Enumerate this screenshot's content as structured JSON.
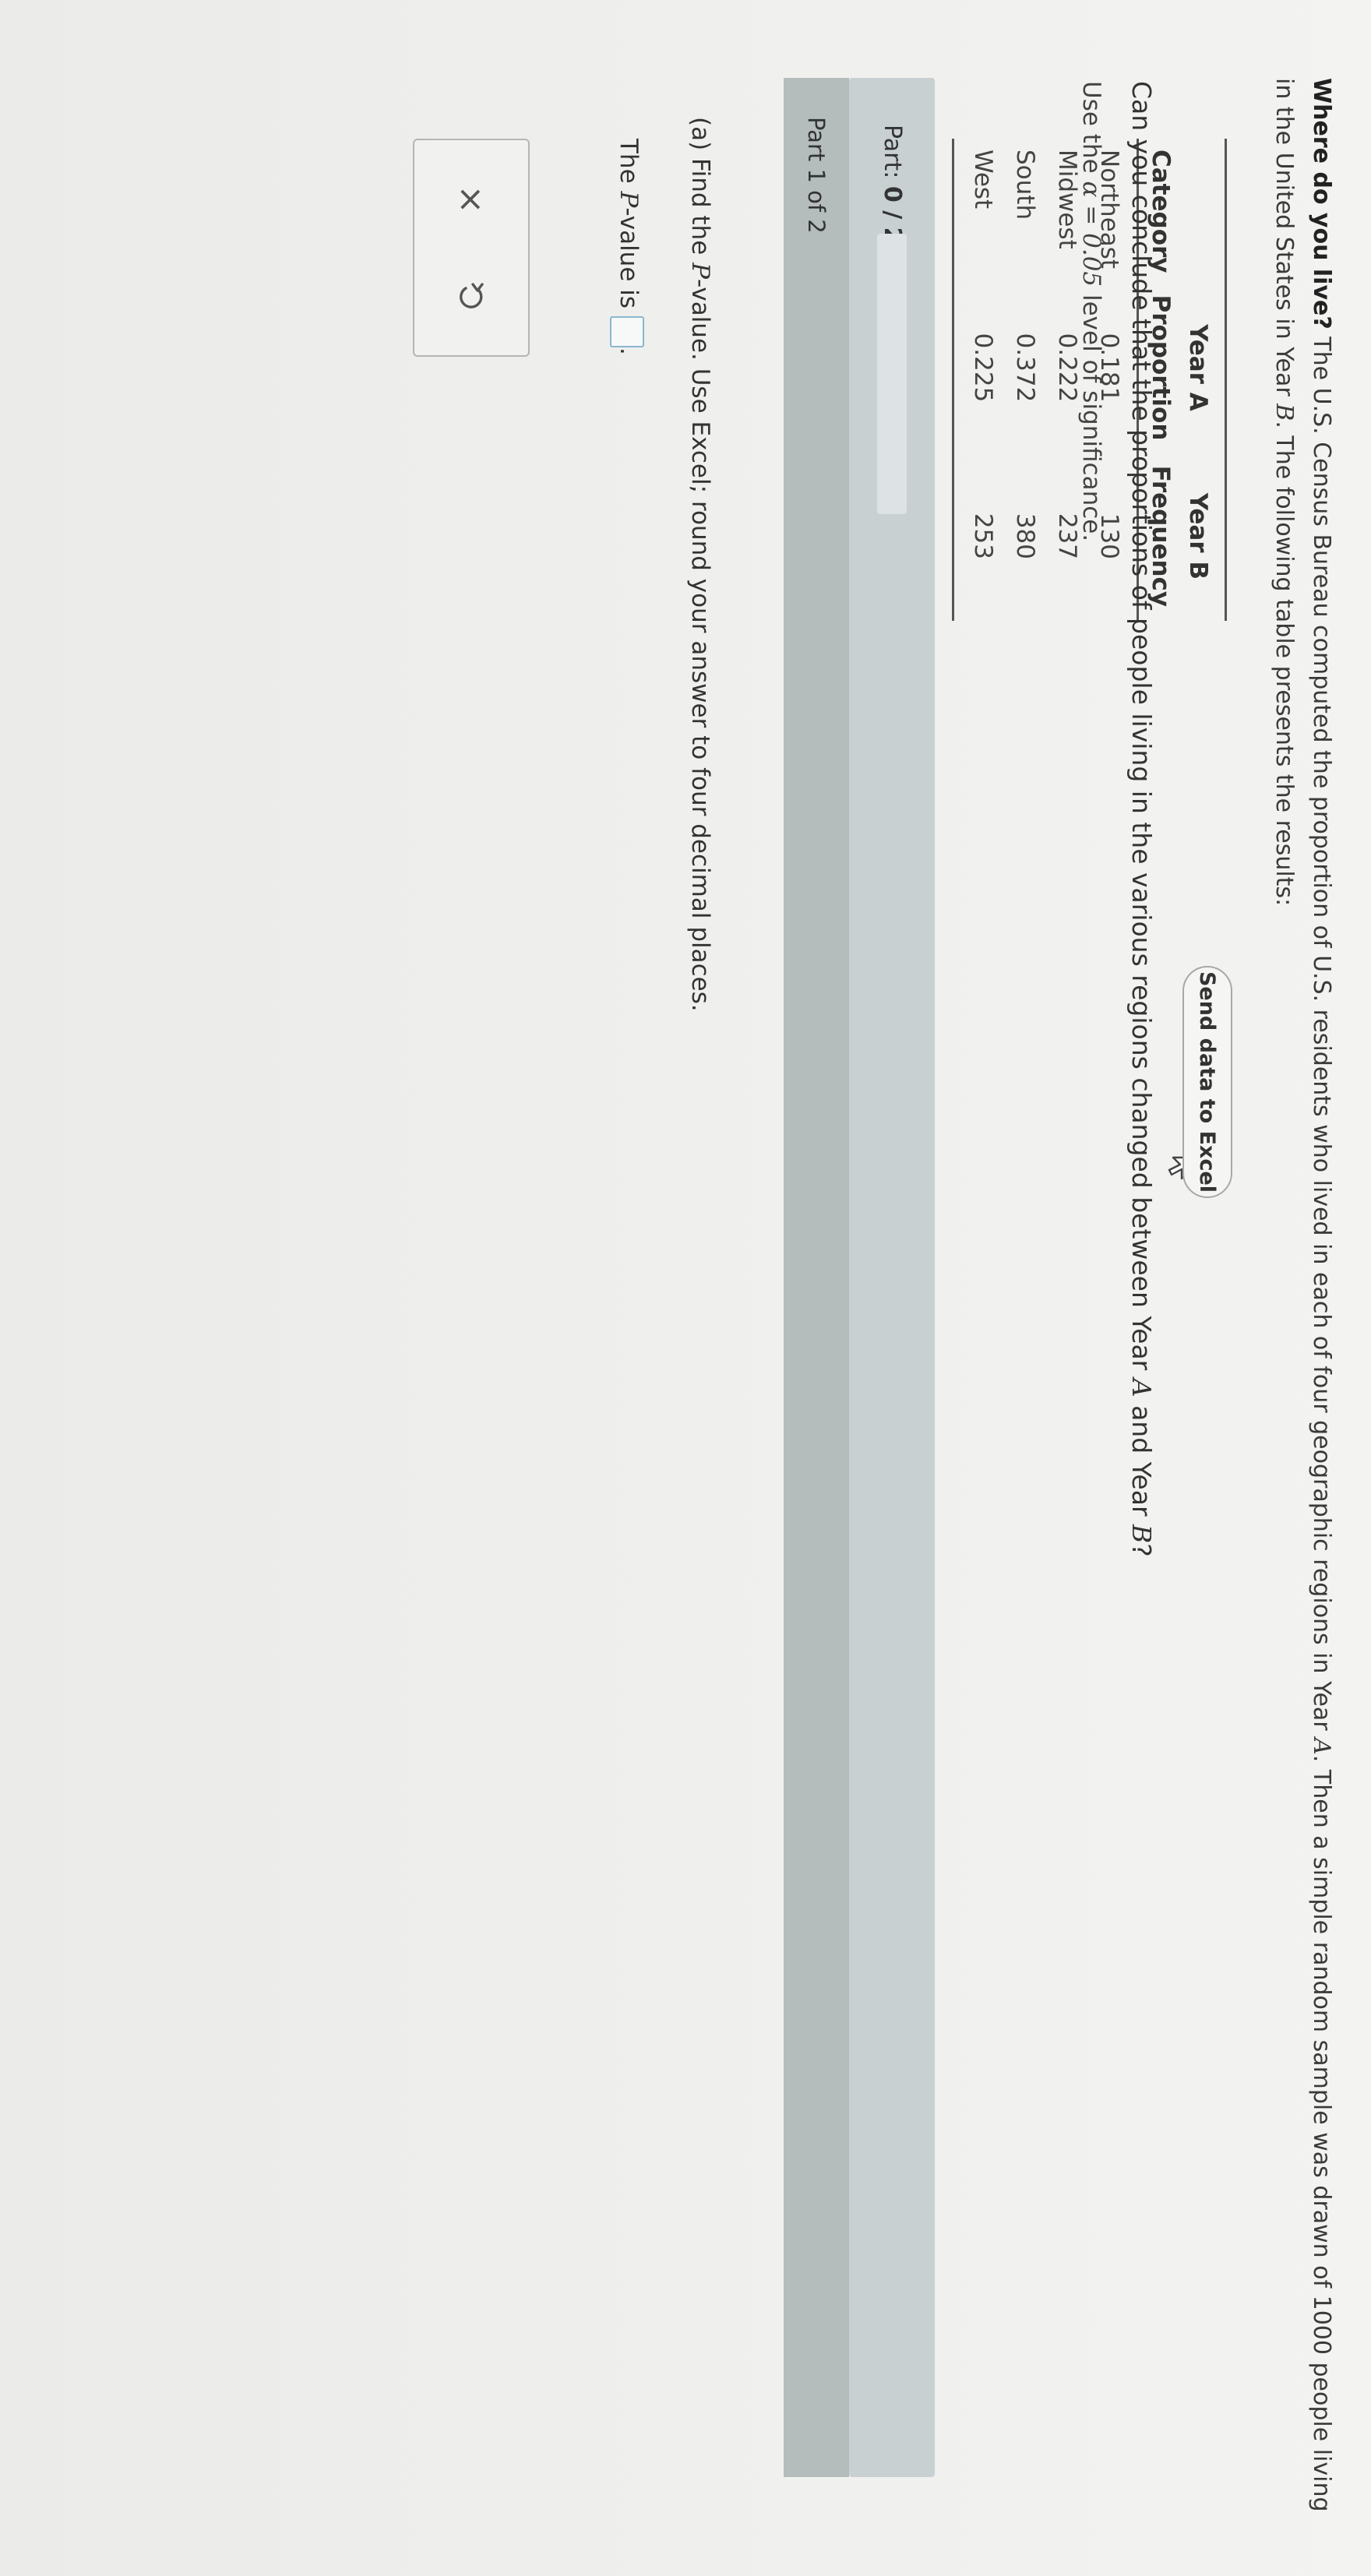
{
  "intro": {
    "bold_lead": "Where do you live?",
    "text_1": " The U.S. Census Bureau computed the proportion of U.S. residents who lived in each of four geographic regions in Year ",
    "var_a": "A",
    "text_2": ". Then a simple random sample was drawn of 1000 people living in the United States in Year ",
    "var_b": "B",
    "text_3": ". The following table presents the results:"
  },
  "table": {
    "header_row1": [
      "",
      "Year A",
      "Year B"
    ],
    "header_row2": [
      "Category",
      "Proportion",
      "Frequency"
    ],
    "rows": [
      {
        "category": "Northeast",
        "proportion": "0.181",
        "frequency": "130"
      },
      {
        "category": "Midwest",
        "proportion": "0.222",
        "frequency": "237"
      },
      {
        "category": "South",
        "proportion": "0.372",
        "frequency": "380"
      },
      {
        "category": "West",
        "proportion": "0.225",
        "frequency": "253"
      }
    ]
  },
  "excel_button": "Send data to Excel",
  "question": {
    "text_1": "Can you conclude that the proportions of people living in the various regions changed between Year ",
    "var_a": "A",
    "text_2": " and Year ",
    "var_b": "B",
    "text_3": "?"
  },
  "alpha_line": {
    "text_1": "Use the ",
    "math": "α = 0.05",
    "text_2": " level of significance."
  },
  "part": {
    "label": "Part: ",
    "score": "0 / 2",
    "progress_fraction": 0
  },
  "part1": {
    "label": "Part 1 of 2"
  },
  "instruction": {
    "text_1": "(a) Find the ",
    "var_p": "P",
    "text_2": "-value. Use Excel; round your answer to four decimal places."
  },
  "pvalue_line": {
    "text_1": "The ",
    "var_p": "P",
    "text_2": "-value is",
    "text_3": "."
  },
  "tools": {
    "clear_symbol": "×"
  },
  "icons": [
    "cursor-icon",
    "close-icon",
    "undo-icon"
  ]
}
